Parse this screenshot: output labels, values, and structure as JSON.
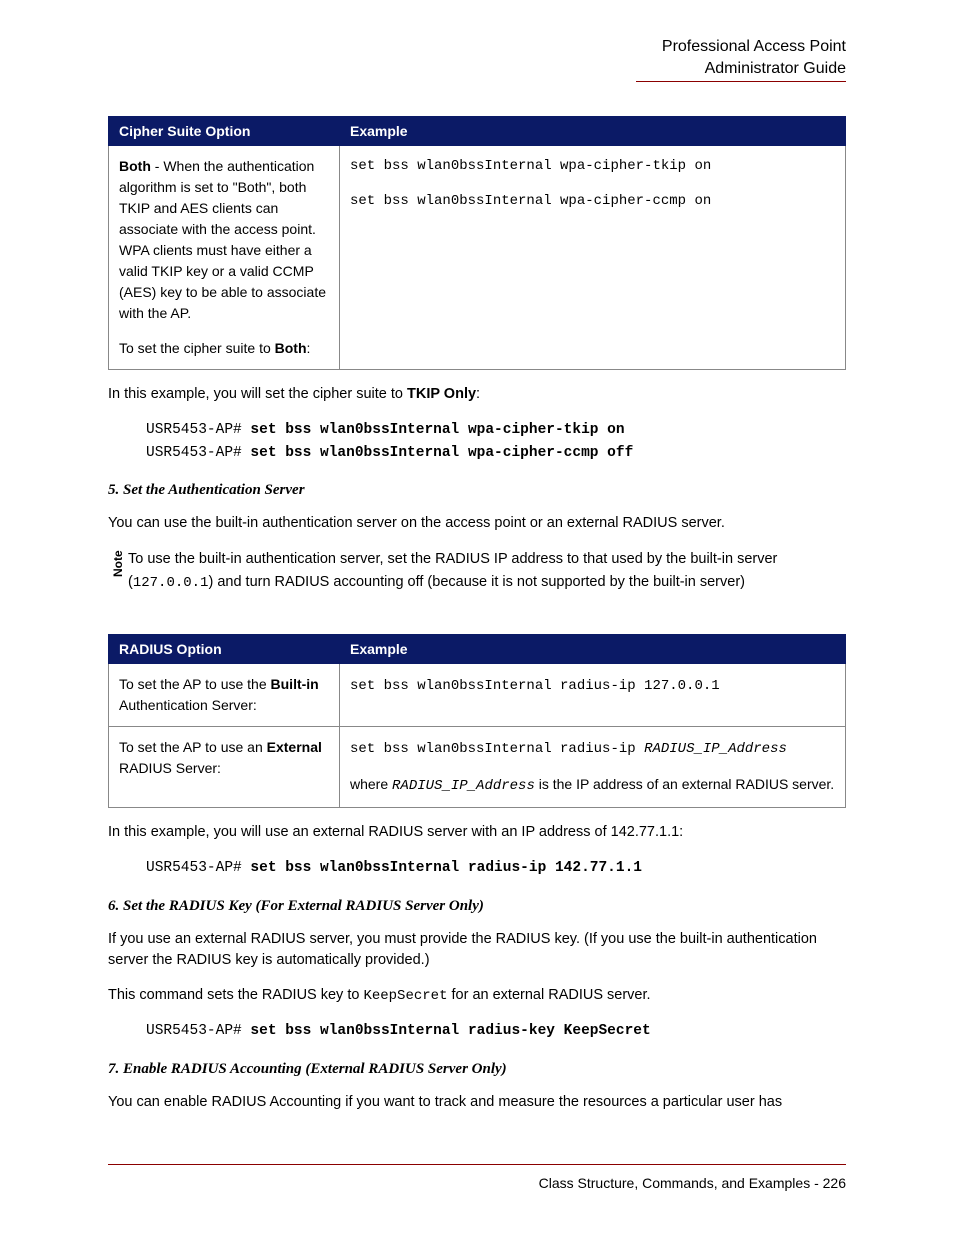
{
  "header": {
    "line1": "Professional Access Point",
    "line2": "Administrator Guide"
  },
  "table1": {
    "headers": {
      "col1": "Cipher Suite Option",
      "col2": "Example"
    },
    "row": {
      "desc_pre": "Both",
      "desc_mid": " - When the authentication algorithm is set to \"Both\", both TKIP and AES clients can associate with the access point. WPA clients must have either a valid TKIP key or a valid CCMP (AES) key to be able to associate with the AP.",
      "desc_line2a": "To set the cipher suite to ",
      "desc_line2b": "Both",
      "desc_line2c": ":",
      "code1": "set bss wlan0bssInternal wpa-cipher-tkip on",
      "code2": "set bss wlan0bssInternal wpa-cipher-ccmp on"
    }
  },
  "para1a": "In this example, you will set the cipher suite to ",
  "para1b": "TKIP Only",
  "para1c": ":",
  "codeblock1": {
    "prompt1": "USR5453-AP# ",
    "cmd1": "set bss wlan0bssInternal wpa-cipher-tkip on",
    "prompt2": "USR5453-AP# ",
    "cmd2": "set bss wlan0bssInternal wpa-cipher-ccmp off"
  },
  "heading5": "5. Set the Authentication Server",
  "para2": "You can use the built-in authentication server on the access point or an external RADIUS server.",
  "note": {
    "label": "Note",
    "line1": "To use the built-in authentication server, set the RADIUS IP address to that used by the built-in server (",
    "ip": "127.0.0.1",
    "line2": ") and turn RADIUS accounting off (because it is not supported by the built-in server)"
  },
  "table2": {
    "headers": {
      "col1": "RADIUS Option",
      "col2": "Example"
    },
    "row1": {
      "desc1": "To set the AP to use the ",
      "desc1b": "Built-in",
      "desc2": " Authentication Server:",
      "code": "set bss wlan0bssInternal radius-ip 127.0.0.1"
    },
    "row2": {
      "desc1": "To set the AP to use an ",
      "desc1b": "External",
      "desc2": " RADIUS Server:",
      "code_pre": "set bss wlan0bssInternal radius-ip ",
      "code_var": "RADIUS_IP_Address",
      "note_pre": "where ",
      "note_var": "RADIUS_IP_Address",
      "note_post": " is the IP address of an external RADIUS server."
    }
  },
  "para3": "In this example, you will use an external RADIUS server with an IP address of 142.77.1.1:",
  "codeblock2": {
    "prompt": "USR5453-AP# ",
    "cmd": "set bss wlan0bssInternal radius-ip 142.77.1.1"
  },
  "heading6": "6. Set the RADIUS Key (For External RADIUS Server Only)",
  "para4": "If you use an external RADIUS server, you must provide the RADIUS key. (If you use the built-in authentication server the RADIUS key is automatically provided.)",
  "para5a": "This command sets the RADIUS key to ",
  "para5b": "KeepSecret",
  "para5c": " for an external RADIUS server.",
  "codeblock3": {
    "prompt": "USR5453-AP# ",
    "cmd": "set bss wlan0bssInternal radius-key KeepSecret"
  },
  "heading7": "7. Enable RADIUS Accounting (External RADIUS Server Only)",
  "para6": "You can enable RADIUS Accounting if you want to track and measure the resources a particular user has",
  "footer": "Class Structure, Commands, and Examples - 226"
}
